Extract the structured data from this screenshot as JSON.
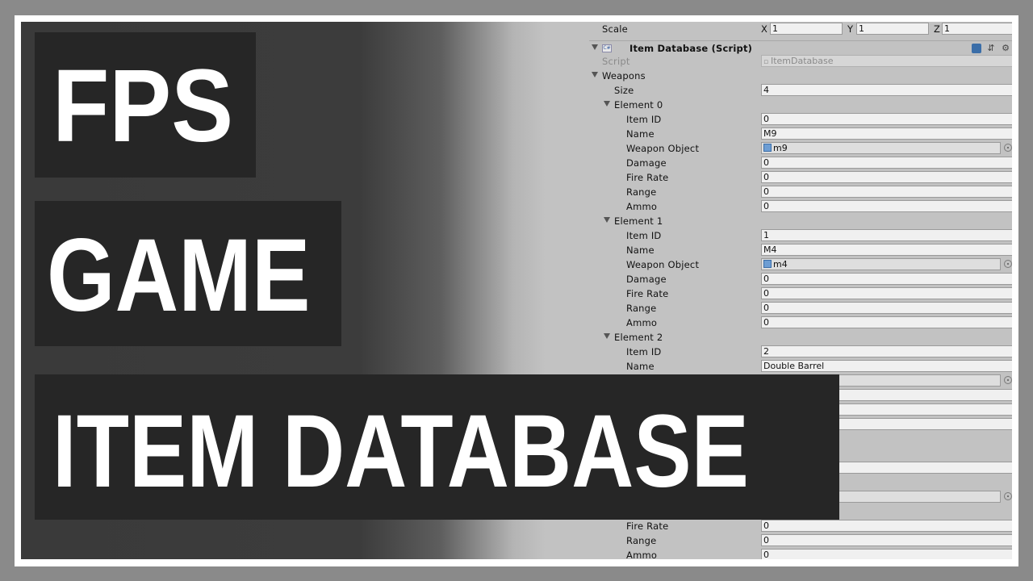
{
  "thumbnail": {
    "title_lines": [
      "FPS",
      "GAME",
      "ITEM DATABASE"
    ]
  },
  "inspector": {
    "scale": {
      "label": "Scale",
      "x_label": "X",
      "x": "1",
      "y_label": "Y",
      "y": "1",
      "z_label": "Z",
      "z": "1"
    },
    "component": {
      "title": "Item Database (Script)",
      "icon": "csharp-script-icon"
    },
    "script": {
      "label": "Script",
      "value": "ItemDatabase"
    },
    "weapons": {
      "label": "Weapons",
      "size_label": "Size",
      "size": "4"
    },
    "elements": [
      {
        "title": "Element 0",
        "item_id": "0",
        "name": "M9",
        "weapon_object": "m9",
        "damage": "0",
        "fire_rate": "0",
        "range": "0",
        "ammo": "0"
      },
      {
        "title": "Element 1",
        "item_id": "1",
        "name": "M4",
        "weapon_object": "m4",
        "damage": "0",
        "fire_rate": "0",
        "range": "0",
        "ammo": "0"
      },
      {
        "title": "Element 2",
        "item_id": "2",
        "name": "Double Barrel"
      }
    ],
    "tail_rows": {
      "fire_rate": "0",
      "range": "0",
      "ammo": "0"
    },
    "field_labels": {
      "item_id": "Item ID",
      "name": "Name",
      "weapon_object": "Weapon Object",
      "damage": "Damage",
      "fire_rate": "Fire Rate",
      "range": "Range",
      "ammo": "Ammo"
    }
  }
}
